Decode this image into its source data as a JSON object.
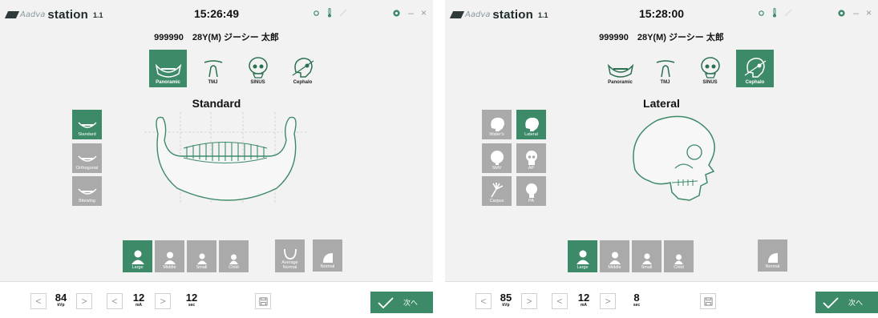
{
  "app": {
    "brand": "Aadva",
    "name": "station",
    "version": "1.1"
  },
  "colors": {
    "accent": "#3d8a68",
    "inactive": "#aaaaaa",
    "background": "#f2f2f2"
  },
  "screens": [
    {
      "clock": "15:26:49",
      "patient": "999990　28Y(M) ジーシー 太郎",
      "modes": [
        {
          "label": "Panoramic",
          "selected": true
        },
        {
          "label": "TMJ",
          "selected": false
        },
        {
          "label": "SINUS",
          "selected": false
        },
        {
          "label": "Cephalo",
          "selected": false
        }
      ],
      "heading": "Standard",
      "side_buttons": [
        {
          "label": "Standard",
          "selected": true
        },
        {
          "label": "Orthogonal",
          "selected": false
        },
        {
          "label": "Bitewing",
          "selected": false
        }
      ],
      "sizes": [
        {
          "label": "Large",
          "selected": true
        },
        {
          "label": "Middle",
          "selected": false
        },
        {
          "label": "Small",
          "selected": false
        },
        {
          "label": "Child",
          "selected": false
        }
      ],
      "shape_buttons": [
        {
          "label": "Average Normal"
        },
        {
          "label": "Normal"
        }
      ],
      "kv": {
        "value": "84",
        "unit": "kVp"
      },
      "ma": {
        "value": "12",
        "unit": "mA"
      },
      "sec": {
        "value": "12",
        "unit": "sec"
      },
      "next_label": "次へ"
    },
    {
      "clock": "15:28:00",
      "patient": "999990　28Y(M) ジーシー 太郎",
      "modes": [
        {
          "label": "Panoramic",
          "selected": false
        },
        {
          "label": "TMJ",
          "selected": false
        },
        {
          "label": "SINUS",
          "selected": false
        },
        {
          "label": "Cephalo",
          "selected": true
        }
      ],
      "heading": "Lateral",
      "side_buttons": [
        {
          "label": "Water's",
          "selected": false
        },
        {
          "label": "Lateral",
          "selected": true
        },
        {
          "label": "SMV",
          "selected": false
        },
        {
          "label": "AP",
          "selected": false
        },
        {
          "label": "Carpus",
          "selected": false
        },
        {
          "label": "PA",
          "selected": false
        }
      ],
      "sizes": [
        {
          "label": "Large",
          "selected": true
        },
        {
          "label": "Middle",
          "selected": false
        },
        {
          "label": "Small",
          "selected": false
        },
        {
          "label": "Child",
          "selected": false
        }
      ],
      "shape_buttons": [
        {
          "label": "Normal"
        }
      ],
      "kv": {
        "value": "85",
        "unit": "kVp"
      },
      "ma": {
        "value": "12",
        "unit": "mA"
      },
      "sec": {
        "value": "8",
        "unit": "sec"
      },
      "next_label": "次へ"
    }
  ]
}
